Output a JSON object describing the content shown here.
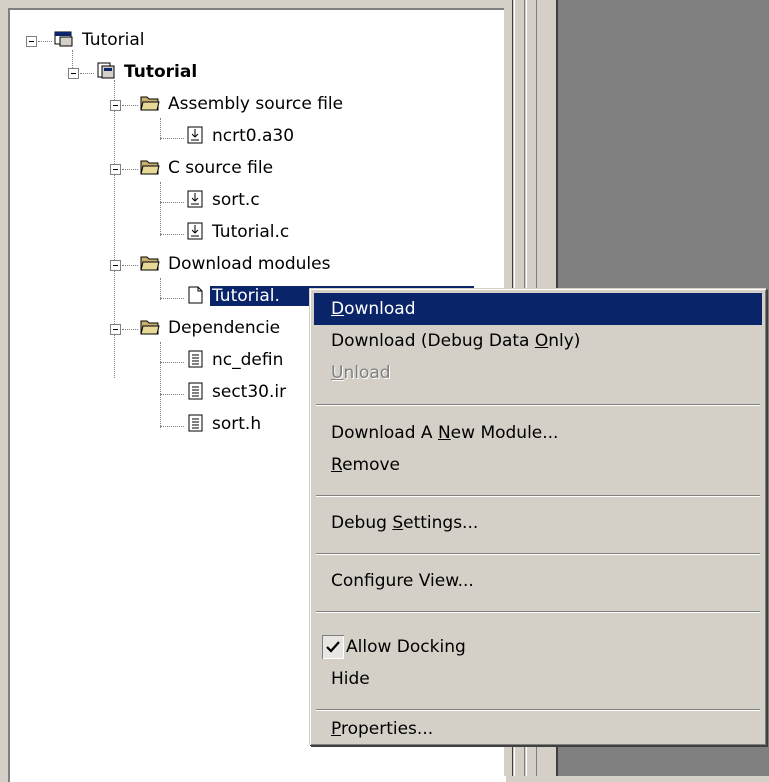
{
  "tree": {
    "workspace": "Tutorial",
    "project": "Tutorial",
    "folders": [
      {
        "label": "Assembly source file",
        "files": [
          "ncrt0.a30"
        ]
      },
      {
        "label": "C source file",
        "files": [
          "sort.c",
          "Tutorial.c"
        ]
      },
      {
        "label": "Download modules",
        "files": [
          "Tutorial."
        ]
      },
      {
        "label": "Dependencie",
        "files": [
          "nc_defin",
          "sect30.ir",
          "sort.h"
        ]
      }
    ]
  },
  "context_menu": {
    "download": {
      "pre": "",
      "u": "D",
      "post": "ownload"
    },
    "download_debug": {
      "pre": "Download (Debug Data ",
      "u": "O",
      "post": "nly)"
    },
    "unload": {
      "pre": "",
      "u": "U",
      "post": "nload"
    },
    "download_new": {
      "pre": "Download A ",
      "u": "N",
      "post": "ew Module..."
    },
    "remove": {
      "pre": "",
      "u": "R",
      "post": "emove"
    },
    "debug_settings": {
      "pre": "Debug ",
      "u": "S",
      "post": "ettings..."
    },
    "configure_view": "Configure View...",
    "allow_docking": "Allow Docking",
    "allow_docking_checked": true,
    "hide": "Hide",
    "properties": {
      "pre": "",
      "u": "P",
      "post": "roperties..."
    }
  },
  "colors": {
    "highlight": "#0a246a",
    "face": "#d4d0c8",
    "dark": "#808080"
  }
}
